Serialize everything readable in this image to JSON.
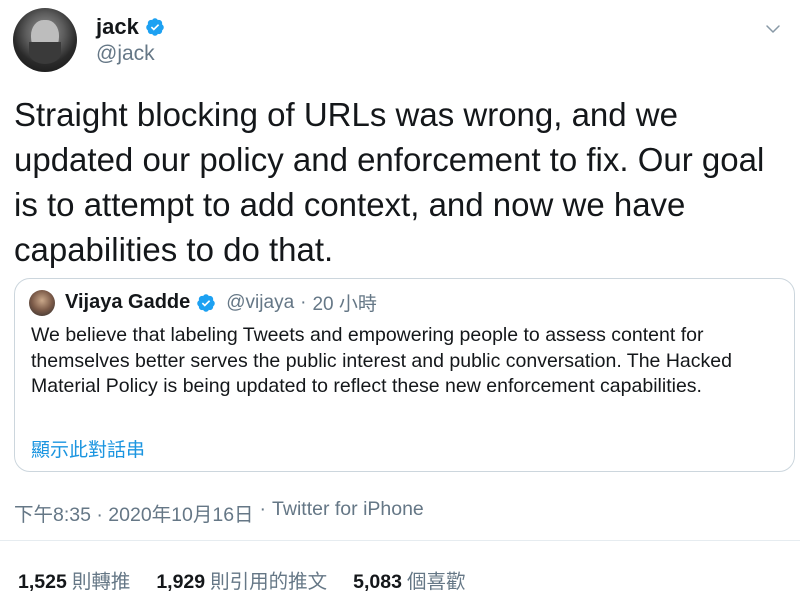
{
  "author": {
    "display_name": "jack",
    "handle": "@jack",
    "verified": true
  },
  "tweet": {
    "text": "Straight blocking of URLs was wrong, and we\nupdated our policy and enforcement to fix. Our goal\nis to attempt to add context, and now we have\ncapabilities to do that.",
    "timestamp": "下午8:35 · 2020年10月16日",
    "separator": "·",
    "source": "Twitter for iPhone"
  },
  "quoted": {
    "display_name": "Vijaya Gadde",
    "handle": "@vijaya",
    "separator": "·",
    "time": "20 小時",
    "text": "We believe that labeling Tweets and empowering people to assess content for themselves better serves the public interest and public conversation. The Hacked Material Policy is being updated to reflect these new enforcement capabilities.",
    "show_thread": "顯示此對話串"
  },
  "stats": [
    {
      "value": "1,525",
      "label": "則轉推"
    },
    {
      "value": "1,929",
      "label": "則引用的推文"
    },
    {
      "value": "5,083",
      "label": "個喜歡"
    }
  ],
  "colors": {
    "text": "#14171a",
    "secondary": "#657786",
    "accent": "#1da1f2",
    "link": "#1b95e0",
    "border": "#ccd6dd"
  },
  "icons": {
    "verified": "verified-badge-icon",
    "caret": "chevron-down-icon"
  }
}
